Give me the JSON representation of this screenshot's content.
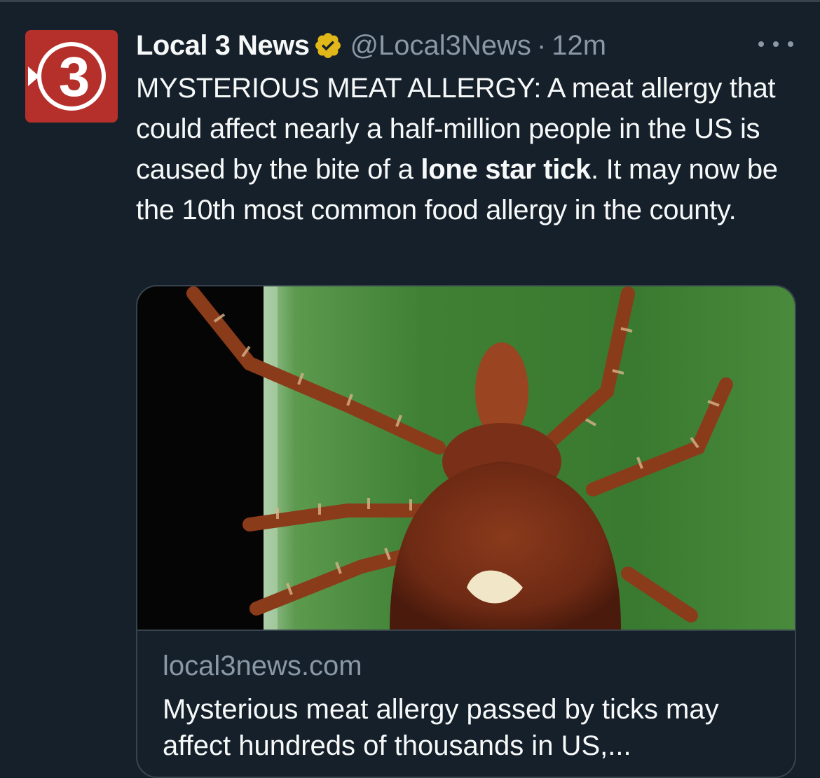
{
  "tweet": {
    "display_name": "Local 3 News",
    "handle": "@Local3News",
    "separator": "·",
    "time": "12m",
    "avatar_text": "3",
    "text_part1": "MYSTERIOUS MEAT ALLERGY: A meat allergy that could affect nearly a half-million people in the US is caused by the bite of a ",
    "text_bold": "lone star tick",
    "text_part2": ". It may now be the 10th most common food allergy in the county."
  },
  "card": {
    "domain": "local3news.com",
    "title": "Mysterious meat allergy passed by ticks may affect hundreds of thousands in US,..."
  },
  "icons": {
    "verified": "verified-badge-icon",
    "more": "more-horizontal-icon"
  },
  "colors": {
    "background": "#15202b",
    "avatar_red": "#b5302b",
    "verified_gold": "#e2b719",
    "secondary_text": "#8b98a5",
    "border": "#38444d"
  }
}
